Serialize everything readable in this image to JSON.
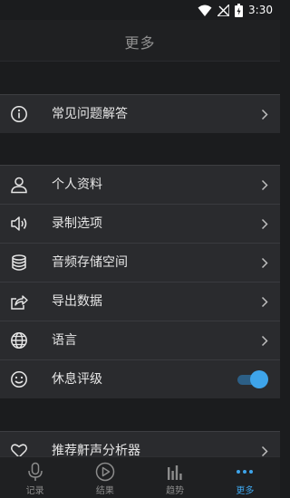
{
  "status_bar": {
    "time": "3:30"
  },
  "header": {
    "title": "更多"
  },
  "group1": [
    {
      "label": "常见问题解答",
      "icon": "info-icon"
    }
  ],
  "group2": [
    {
      "label": "个人资料",
      "icon": "user-icon"
    },
    {
      "label": "录制选项",
      "icon": "speaker-icon"
    },
    {
      "label": "音频存储空间",
      "icon": "database-icon"
    },
    {
      "label": "导出数据",
      "icon": "share-icon"
    },
    {
      "label": "语言",
      "icon": "globe-icon"
    },
    {
      "label": "休息评级",
      "icon": "smiley-icon"
    }
  ],
  "rest_rating_toggle": {
    "on": true
  },
  "group3": [
    {
      "label": "推荐鼾声分析器",
      "icon": "heart-icon"
    }
  ],
  "nav": [
    {
      "label": "记录",
      "icon": "microphone-icon"
    },
    {
      "label": "结果",
      "icon": "play-circle-icon"
    },
    {
      "label": "趋势",
      "icon": "bar-chart-icon"
    },
    {
      "label": "更多",
      "icon": "more-dots-icon",
      "active": true
    }
  ],
  "colors": {
    "accent": "#3ea4ea",
    "toggle_track": "#2c5f86",
    "row_bg": "#2a2b2e",
    "page_bg": "#1b1c1e"
  }
}
